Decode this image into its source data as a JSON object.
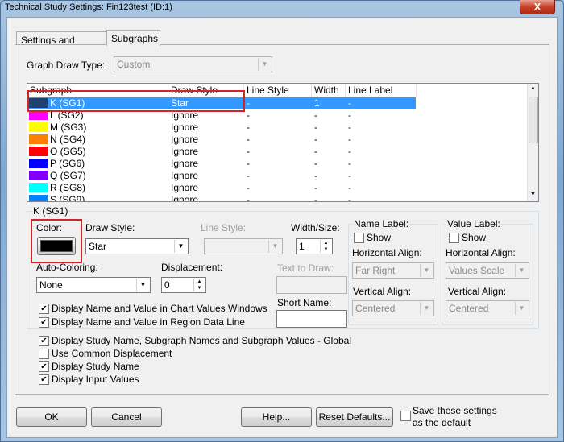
{
  "window": {
    "title": "Technical Study Settings: Fin123test (ID:1)",
    "close_label": "X"
  },
  "tabs": [
    {
      "label": "Settings and Inputs"
    },
    {
      "label": "Subgraphs"
    }
  ],
  "graph_draw_type": {
    "label": "Graph Draw Type:",
    "value": "Custom"
  },
  "list": {
    "headers": [
      "Subgraph",
      "Draw Style",
      "Line Style",
      "Width",
      "Line Label"
    ],
    "rows": [
      {
        "color": "#1f3f6f",
        "name": "K (SG1)",
        "draw": "Star",
        "line": "-",
        "width": "1",
        "label": "-"
      },
      {
        "color": "#ff00ff",
        "name": "L (SG2)",
        "draw": "Ignore",
        "line": "-",
        "width": "-",
        "label": "-"
      },
      {
        "color": "#ffff00",
        "name": "M (SG3)",
        "draw": "Ignore",
        "line": "-",
        "width": "-",
        "label": "-"
      },
      {
        "color": "#ff8000",
        "name": "N (SG4)",
        "draw": "Ignore",
        "line": "-",
        "width": "-",
        "label": "-"
      },
      {
        "color": "#ff0000",
        "name": "O (SG5)",
        "draw": "Ignore",
        "line": "-",
        "width": "-",
        "label": "-"
      },
      {
        "color": "#0000ff",
        "name": "P (SG6)",
        "draw": "Ignore",
        "line": "-",
        "width": "-",
        "label": "-"
      },
      {
        "color": "#8000ff",
        "name": "Q (SG7)",
        "draw": "Ignore",
        "line": "-",
        "width": "-",
        "label": "-"
      },
      {
        "color": "#00ffff",
        "name": "R (SG8)",
        "draw": "Ignore",
        "line": "-",
        "width": "-",
        "label": "-"
      },
      {
        "color": "#0080ff",
        "name": "S (SG9)",
        "draw": "Ignore",
        "line": "-",
        "width": "-",
        "label": "-"
      }
    ]
  },
  "detail": {
    "group_title": "K (SG1)",
    "color_label": "Color:",
    "color_value": "#000000",
    "draw_style_label": "Draw Style:",
    "draw_style_value": "Star",
    "line_style_label": "Line Style:",
    "width_label": "Width/Size:",
    "width_value": "1",
    "auto_coloring_label": "Auto-Coloring:",
    "auto_coloring_value": "None",
    "displacement_label": "Displacement:",
    "displacement_value": "0",
    "text_to_draw_label": "Text to Draw:",
    "short_name_label": "Short Name:",
    "chk_chart_values": "Display Name and Value in Chart Values Windows",
    "chk_region_data": "Display Name and Value in Region Data Line",
    "name_label": {
      "title": "Name Label:",
      "show": "Show",
      "h_align_label": "Horizontal Align:",
      "h_align_value": "Far Right",
      "v_align_label": "Vertical Align:",
      "v_align_value": "Centered"
    },
    "value_label": {
      "title": "Value Label:",
      "show": "Show",
      "h_align_label": "Horizontal Align:",
      "h_align_value": "Values Scale",
      "v_align_label": "Vertical Align:",
      "v_align_value": "Centered"
    }
  },
  "global_options": [
    {
      "label": "Display Study Name, Subgraph Names and Subgraph Values - Global",
      "checked": true
    },
    {
      "label": "Use Common Displacement",
      "checked": false
    },
    {
      "label": "Display Study Name",
      "checked": true
    },
    {
      "label": "Display Input Values",
      "checked": true
    }
  ],
  "buttons": {
    "ok": "OK",
    "cancel": "Cancel",
    "help": "Help...",
    "reset": "Reset Defaults...",
    "save_default": "Save these settings as the default"
  }
}
